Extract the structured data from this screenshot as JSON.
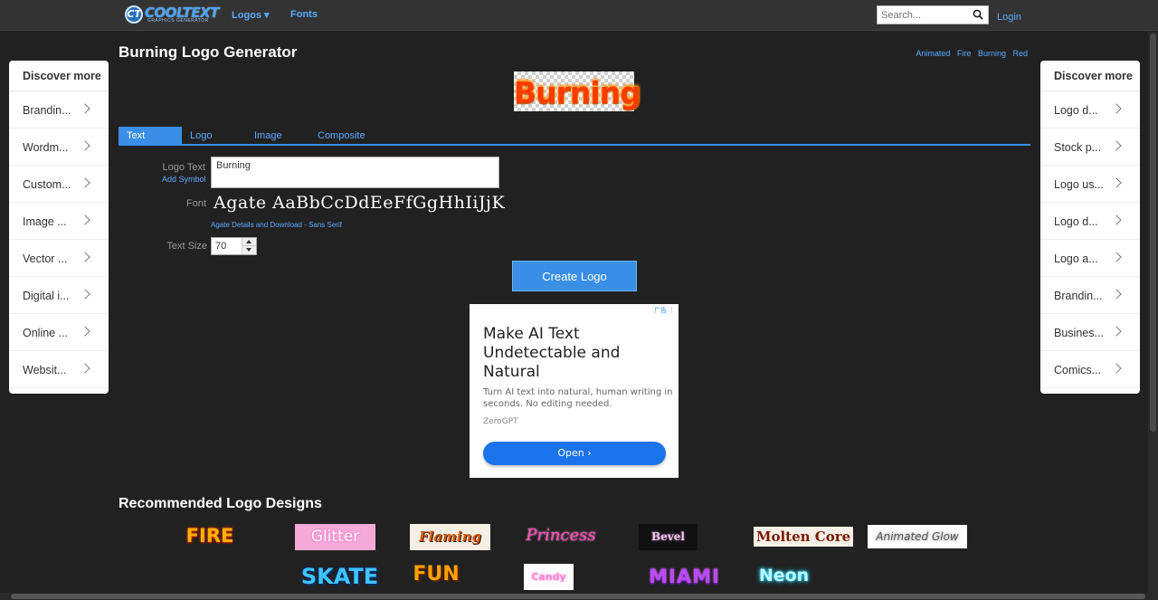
{
  "nav": {
    "logo_text": "COOLTEXT",
    "logo_subtext": "GRAPHICS GENERATOR",
    "logos_label": "Logos ▾",
    "fonts_label": "Fonts",
    "search_placeholder": "Search...",
    "login_label": "Login"
  },
  "page": {
    "title": "Burning Logo Generator",
    "tags": [
      "Animated",
      "Fire",
      "Burning",
      "Red"
    ],
    "preview_text": "Burning"
  },
  "tabs": [
    "Text",
    "Logo",
    "Image",
    "Composite"
  ],
  "form": {
    "logo_text_label": "Logo Text",
    "add_symbol": "Add Symbol",
    "logo_text_value": "Burning",
    "font_label": "Font",
    "font_sample": "Agate AaBbCcDdEeFfGgHhIiJjK",
    "font_details": "Agate Details and Download - Sans Serif",
    "text_size_label": "Text Size",
    "text_size_value": "70",
    "create_button": "Create Logo"
  },
  "ad": {
    "flag": "广告 ⋮",
    "title": "Make AI Text Undetectable and Natural",
    "body": "Turn AI text into natural, human writing in seconds. No editing needed.",
    "brand": "ZeroGPT",
    "button": "Open  ›"
  },
  "left_panel": {
    "title": "Discover more",
    "items": [
      "Brandin...",
      "Wordm...",
      "Custom...",
      "Image ...",
      "Vector ...",
      "Digital i...",
      "Online ...",
      "Websit..."
    ]
  },
  "right_panel": {
    "title": "Discover more",
    "items": [
      "Logo d...",
      "Stock p...",
      "Logo us...",
      "Logo d...",
      "Logo a...",
      "Brandin...",
      "Busines...",
      "Comics..."
    ]
  },
  "recommended": {
    "title": "Recommended Logo Designs",
    "row1": [
      "FIRE",
      "Glitter",
      "Flaming",
      "Princess",
      "Bevel",
      "Molten Core",
      "Animated Glow"
    ],
    "row2": [
      "SKATE",
      "FUN",
      "Candy",
      "MIAMI",
      "Neon"
    ]
  }
}
